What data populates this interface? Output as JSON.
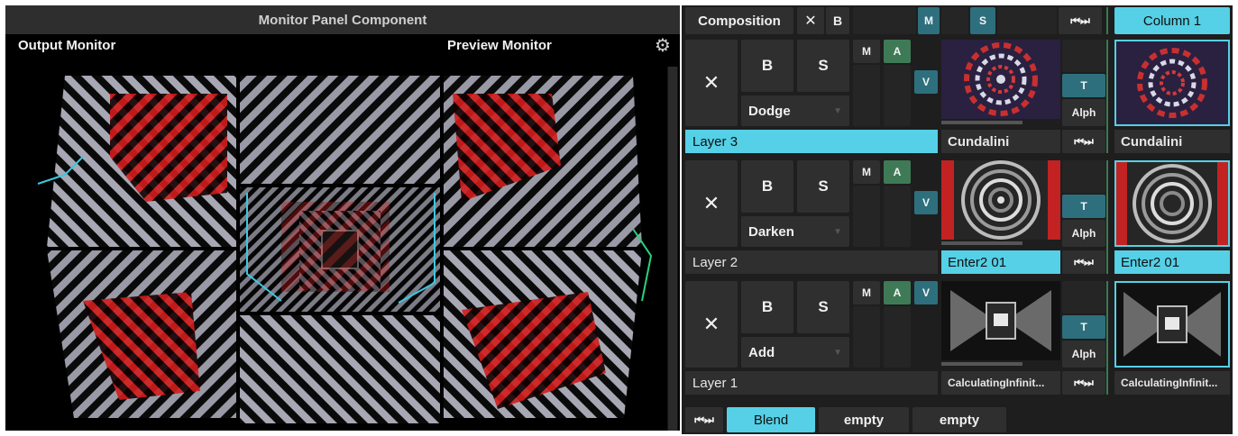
{
  "monitor_panel": {
    "title": "Monitor Panel Component",
    "output_label": "Output Monitor",
    "preview_label": "Preview Monitor",
    "settings_icon": "gear-icon"
  },
  "composition": {
    "label": "Composition",
    "clear_label": "✕",
    "bypass_label": "B",
    "mute_label": "M",
    "solo_label": "S",
    "transport_label": "⏮⏭",
    "column": "Column 1"
  },
  "layers": [
    {
      "name": "Layer 3",
      "clear_label": "✕",
      "bypass_label": "B",
      "solo_label": "S",
      "blend_mode": "Dodge",
      "m_label": "M",
      "a_label": "A",
      "v_label": "V",
      "t_label": "T",
      "alpha_label": "Alph",
      "clip_name": "Cundalini",
      "transport_label": "⏮⏭",
      "column_clip": "Cundalini"
    },
    {
      "name": "Layer 2",
      "clear_label": "✕",
      "bypass_label": "B",
      "solo_label": "S",
      "blend_mode": "Darken",
      "m_label": "M",
      "a_label": "A",
      "v_label": "V",
      "t_label": "T",
      "alpha_label": "Alph",
      "clip_name": "Enter2 01",
      "transport_label": "⏮⏭",
      "column_clip": "Enter2 01"
    },
    {
      "name": "Layer 1",
      "clear_label": "✕",
      "bypass_label": "B",
      "solo_label": "S",
      "blend_mode": "Add",
      "m_label": "M",
      "a_label": "A",
      "v_label": "V",
      "t_label": "T",
      "alpha_label": "Alph",
      "clip_name": "CalculatingInfinit...",
      "transport_label": "⏮⏭",
      "column_clip": "CalculatingInfinit..."
    }
  ],
  "bottom_bar": {
    "transport_label": "⏮⏭",
    "tabs": [
      "Blend",
      "empty",
      "empty"
    ]
  },
  "colors": {
    "accent_cyan": "#55d0e6",
    "teal": "#2e6f7d",
    "green": "#3f7a57",
    "panel": "#1e1e1e"
  }
}
